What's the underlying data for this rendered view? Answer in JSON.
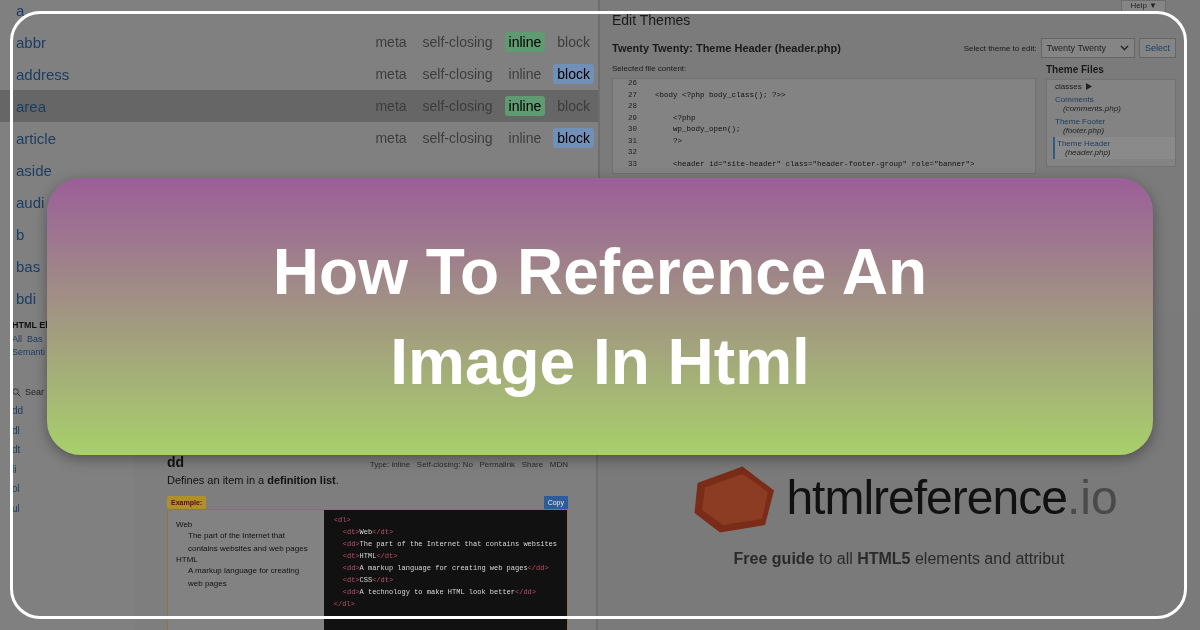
{
  "element_list": {
    "rows": [
      {
        "name": "a",
        "selected": false
      },
      {
        "name": "abbr",
        "selected": false,
        "tags": [
          {
            "label": "meta",
            "active": false
          },
          {
            "label": "self-closing",
            "active": false
          },
          {
            "label": "inline",
            "active": true
          },
          {
            "label": "block",
            "active": false
          }
        ]
      },
      {
        "name": "address",
        "selected": false,
        "tags": [
          {
            "label": "meta",
            "active": false
          },
          {
            "label": "self-closing",
            "active": false
          },
          {
            "label": "inline",
            "active": false
          },
          {
            "label": "block",
            "active": true
          }
        ]
      },
      {
        "name": "area",
        "selected": true,
        "tags": [
          {
            "label": "meta",
            "active": false
          },
          {
            "label": "self-closing",
            "active": false
          },
          {
            "label": "inline",
            "active": true
          },
          {
            "label": "block",
            "active": false
          }
        ]
      },
      {
        "name": "article",
        "selected": false,
        "tags": [
          {
            "label": "meta",
            "active": false
          },
          {
            "label": "self-closing",
            "active": false
          },
          {
            "label": "inline",
            "active": false
          },
          {
            "label": "block",
            "active": true
          }
        ]
      },
      {
        "name": "aside",
        "selected": false
      },
      {
        "name": "audi",
        "selected": false
      },
      {
        "name": "b",
        "selected": false
      },
      {
        "name": "bas",
        "selected": false
      },
      {
        "name": "bdi",
        "selected": false
      }
    ]
  },
  "theme_editor": {
    "help_tab": {
      "label": "Help",
      "caret": "▼"
    },
    "title": "Edit Themes",
    "file_title": "Twenty Twenty: Theme Header (header.php)",
    "select_label": "Select theme to edit:",
    "theme_select": "Twenty Twenty",
    "select_button": "Select",
    "content_label": "Selected file content:",
    "code_lines": [
      {
        "number": "26"
      },
      {
        "number": "27",
        "code": "<body <?php body_class(); ?>>"
      },
      {
        "number": "28"
      },
      {
        "number": "29",
        "code": "    <?php"
      },
      {
        "number": "30",
        "code": "    wp_body_open();"
      },
      {
        "number": "31",
        "code": "    ?>"
      },
      {
        "number": "32"
      },
      {
        "number": "33",
        "code": "    <header id=\"site-header\" class=\"header-footer-group\" role=\"banner\">"
      }
    ],
    "files_title": "Theme Files",
    "files": [
      {
        "name": "classes",
        "folder": true,
        "selected": false
      },
      {
        "name": "Comments",
        "file": "(comments.php)",
        "folder": false,
        "selected": false
      },
      {
        "name": "Theme Footer",
        "file": "(footer.php)",
        "folder": false,
        "selected": false
      },
      {
        "name": "Theme Header",
        "file": "(header.php)",
        "folder": false,
        "selected": true
      }
    ]
  },
  "reference_sidebar": {
    "title": "HTML El",
    "filters": [
      "All",
      "Bas",
      "Semanti"
    ],
    "search_placeholder": "Sear",
    "items": [
      "dd",
      "dl",
      "dt",
      "li",
      "ol",
      "ul"
    ]
  },
  "reference_page": {
    "heading": "dd",
    "meta": "Type: inline   Self-closing: No   Permalink   Share   MDN",
    "description": "Defines an item in a **definition list**.",
    "example_label": "Example:",
    "copy_button": "Copy",
    "preview": [
      {
        "kind": "term",
        "text": "Web"
      },
      {
        "kind": "definition",
        "text": "The part of the Internet that contains websites and web pages"
      },
      {
        "kind": "term",
        "text": "HTML"
      },
      {
        "kind": "definition",
        "text": "A markup language for creating web pages"
      }
    ],
    "code": [
      {
        "indented": false,
        "parts": [
          {
            "kind": "tag",
            "text": "<dl>"
          }
        ]
      },
      {
        "indented": true,
        "parts": [
          {
            "kind": "tag",
            "text": "<dt>"
          },
          {
            "kind": "text",
            "text": "Web"
          },
          {
            "kind": "tag",
            "text": "</dt>"
          }
        ]
      },
      {
        "indented": true,
        "parts": [
          {
            "kind": "tag",
            "text": "<dd>"
          },
          {
            "kind": "text",
            "text": "The part of the Internet that contains websites"
          }
        ]
      },
      {
        "indented": true,
        "parts": [
          {
            "kind": "tag",
            "text": "<dt>"
          },
          {
            "kind": "text",
            "text": "HTML"
          },
          {
            "kind": "tag",
            "text": "</dt>"
          }
        ]
      },
      {
        "indented": true,
        "parts": [
          {
            "kind": "tag",
            "text": "<dd>"
          },
          {
            "kind": "text",
            "text": "A markup language for creating web pages"
          },
          {
            "kind": "tag",
            "text": "</dd>"
          }
        ]
      },
      {
        "indented": true,
        "parts": [
          {
            "kind": "tag",
            "text": "<dt>"
          },
          {
            "kind": "text",
            "text": "CSS"
          },
          {
            "kind": "tag",
            "text": "</dt>"
          }
        ]
      },
      {
        "indented": true,
        "parts": [
          {
            "kind": "tag",
            "text": "<dd>"
          },
          {
            "kind": "text",
            "text": "A technology to make HTML look better"
          },
          {
            "kind": "tag",
            "text": "</dd>"
          }
        ]
      },
      {
        "indented": false,
        "parts": [
          {
            "kind": "tag",
            "text": "</dl>"
          }
        ]
      }
    ]
  },
  "brand": {
    "name": "htmlreference",
    "suffix": ".io",
    "tagline": "**Free guide** to all **HTML5** elements and attribut"
  },
  "banner": {
    "title_lines": [
      "How To Reference An",
      "Image In Html"
    ]
  }
}
